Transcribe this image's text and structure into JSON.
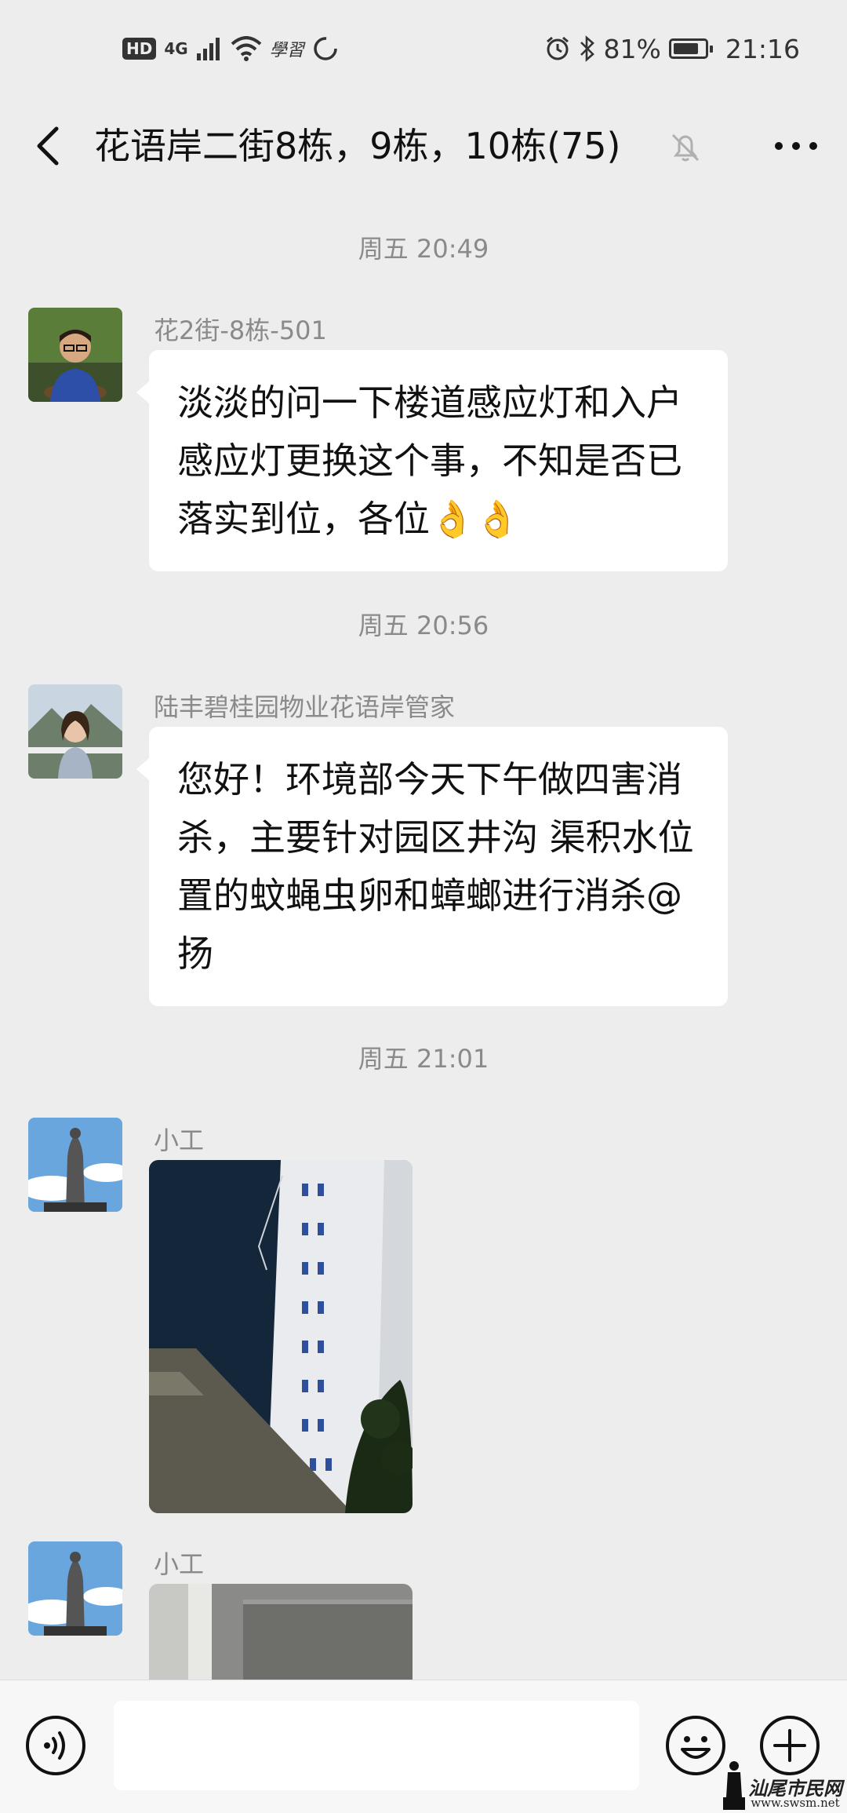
{
  "status_bar": {
    "hd": "HD",
    "network": "4G",
    "app_text": "學習",
    "battery": "81%",
    "battery_level": 0.81,
    "time": "21:16"
  },
  "header": {
    "title": "花语岸二街8栋，9栋，10栋(75)"
  },
  "messages": [
    {
      "type": "timestamp",
      "text": "周五 20:49"
    },
    {
      "type": "text",
      "sender": "花2街-8栋-501",
      "text": "淡淡的问一下楼道感应灯和入户感应灯更换这个事，不知是否已落实到位，各位👌👌"
    },
    {
      "type": "timestamp",
      "text": "周五 20:56"
    },
    {
      "type": "text",
      "sender": "陆丰碧桂园物业花语岸管家",
      "text": "您好！环境部今天下午做四害消杀，主要针对园区井沟  渠积水位置的蚊蝇虫卵和蟑螂进行消杀@扬"
    },
    {
      "type": "timestamp",
      "text": "周五 21:01"
    },
    {
      "type": "image",
      "sender": "小工"
    },
    {
      "type": "image",
      "sender": "小工"
    }
  ],
  "input": {
    "value": "",
    "placeholder": ""
  },
  "watermark": {
    "text": "汕尾市民网",
    "url": "www.swsm.net"
  },
  "colors": {
    "background": "#ededed",
    "bubble": "#ffffff",
    "meta_text": "#8a8a8a"
  }
}
